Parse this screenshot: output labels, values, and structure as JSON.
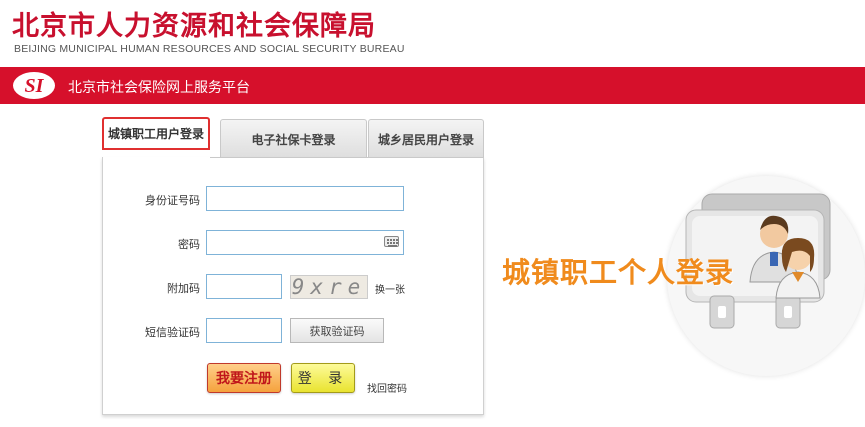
{
  "header": {
    "bureau_name_cn": "北京市人力资源和社会保障局",
    "bureau_name_en": "BEIJING MUNICIPAL HUMAN RESOURCES AND SOCIAL SECURITY BUREAU"
  },
  "banner": {
    "logo_text": "SI",
    "platform_title": "北京市社会保险网上服务平台",
    "color": "#d6102b"
  },
  "tabs": [
    {
      "label": "城镇职工用户登录",
      "active": true
    },
    {
      "label": "电子社保卡登录",
      "active": false
    },
    {
      "label": "城乡居民用户登录",
      "active": false
    }
  ],
  "form": {
    "id_label": "身份证号码",
    "password_label": "密码",
    "captcha_label": "附加码",
    "captcha_text": "9xre",
    "refresh_captcha": "换一张",
    "sms_label": "短信验证码",
    "get_sms_button": "获取验证码",
    "register_button": "我要注册",
    "login_button": "登 录",
    "forgot_password": "找回密码"
  },
  "promo": {
    "text": "城镇职工个人登录",
    "color": "#f08b1d",
    "icon": "users-card-icon"
  }
}
